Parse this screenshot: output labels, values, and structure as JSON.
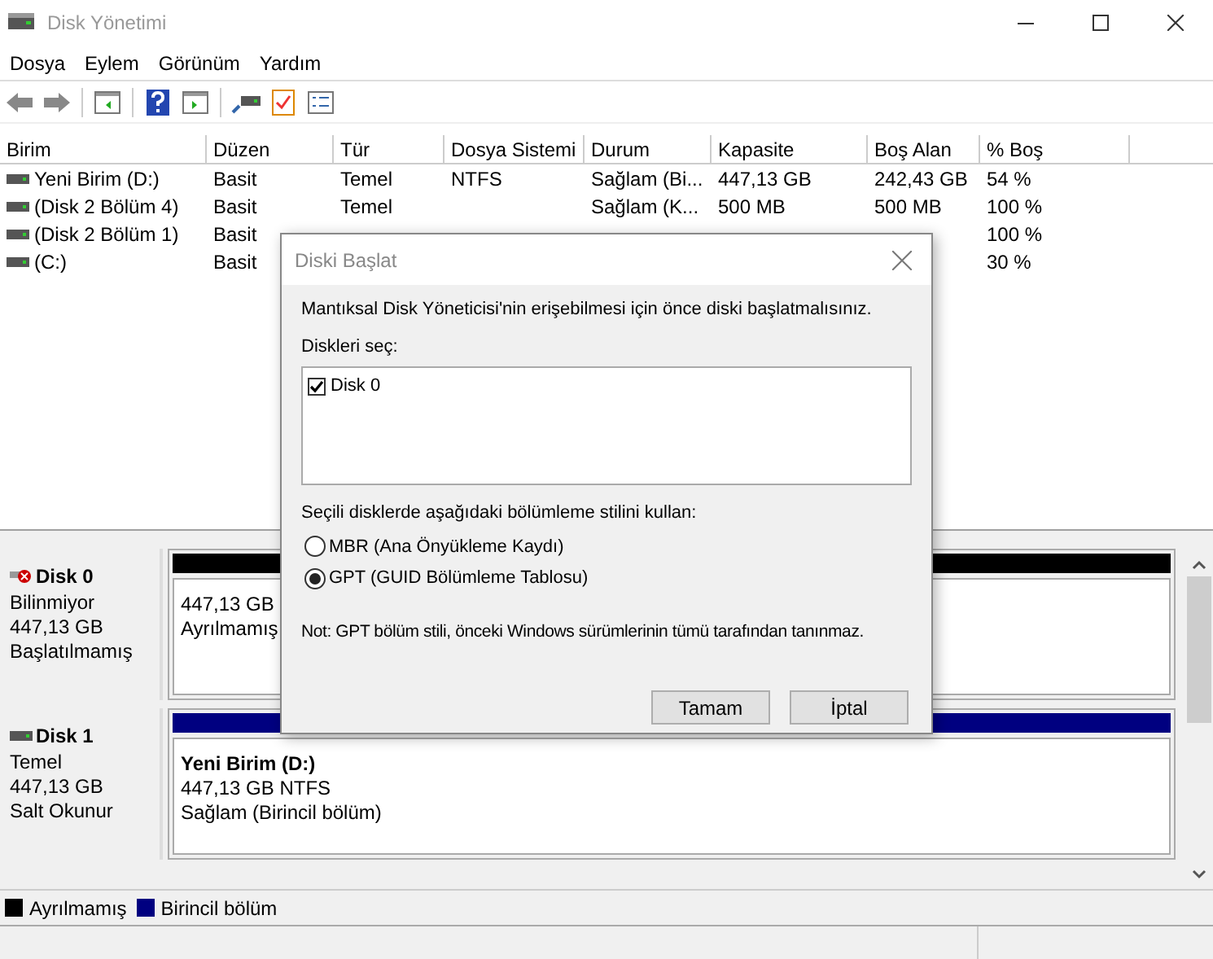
{
  "window": {
    "title": "Disk Yönetimi"
  },
  "menu": [
    "Dosya",
    "Eylem",
    "Görünüm",
    "Yardım"
  ],
  "table": {
    "columns": [
      "Birim",
      "Düzen",
      "Tür",
      "Dosya Sistemi",
      "Durum",
      "Kapasite",
      "Boş Alan",
      "% Boş"
    ],
    "rows": [
      [
        "Yeni Birim (D:)",
        "Basit",
        "Temel",
        "NTFS",
        "Sağlam (Bi...",
        "447,13 GB",
        "242,43 GB",
        "54 %"
      ],
      [
        "(Disk 2 Bölüm 4)",
        "Basit",
        "Temel",
        "",
        "Sağlam (K...",
        "500 MB",
        "500 MB",
        "100 %"
      ],
      [
        "(Disk 2 Bölüm 1)",
        "Basit",
        null,
        null,
        null,
        null,
        null,
        "100 %"
      ],
      [
        "(C:)",
        "Basit",
        null,
        null,
        null,
        null,
        null,
        "30 %"
      ]
    ]
  },
  "disks": [
    {
      "name": "Disk 0",
      "kind": "error",
      "lines": [
        "Bilinmiyor",
        "447,13 GB",
        "Başlatılmamış"
      ],
      "partition": {
        "color": "#000000",
        "lines": [
          "447,13 GB",
          "Ayrılmamış"
        ]
      }
    },
    {
      "name": "Disk 1",
      "kind": "ok",
      "lines": [
        "Temel",
        "447,13 GB",
        "Salt Okunur"
      ],
      "partition": {
        "color": "#000080",
        "title": "Yeni Birim  (D:)",
        "lines": [
          "447,13 GB NTFS",
          "Sağlam (Birincil bölüm)"
        ]
      }
    }
  ],
  "legend": [
    {
      "label": "Ayrılmamış",
      "color": "#000000"
    },
    {
      "label": "Birincil bölüm",
      "color": "#000080"
    }
  ],
  "dialog": {
    "title": "Diski Başlat",
    "message": "Mantıksal Disk Yöneticisi'nin erişebilmesi için önce diski başlatmalısınız.",
    "list_label": "Diskleri seç:",
    "disks": [
      {
        "label": "Disk 0",
        "checked": true
      }
    ],
    "style_label": "Seçili disklerde aşağıdaki bölümleme stilini kullan:",
    "styles": [
      {
        "label": "MBR (Ana Önyükleme Kaydı)",
        "selected": false
      },
      {
        "label": "GPT (GUID Bölümleme Tablosu)",
        "selected": true
      }
    ],
    "note": "Not: GPT bölüm stili, önceki Windows sürümlerinin tümü tarafından tanınmaz.",
    "buttons": [
      "Tamam",
      "İptal"
    ]
  }
}
